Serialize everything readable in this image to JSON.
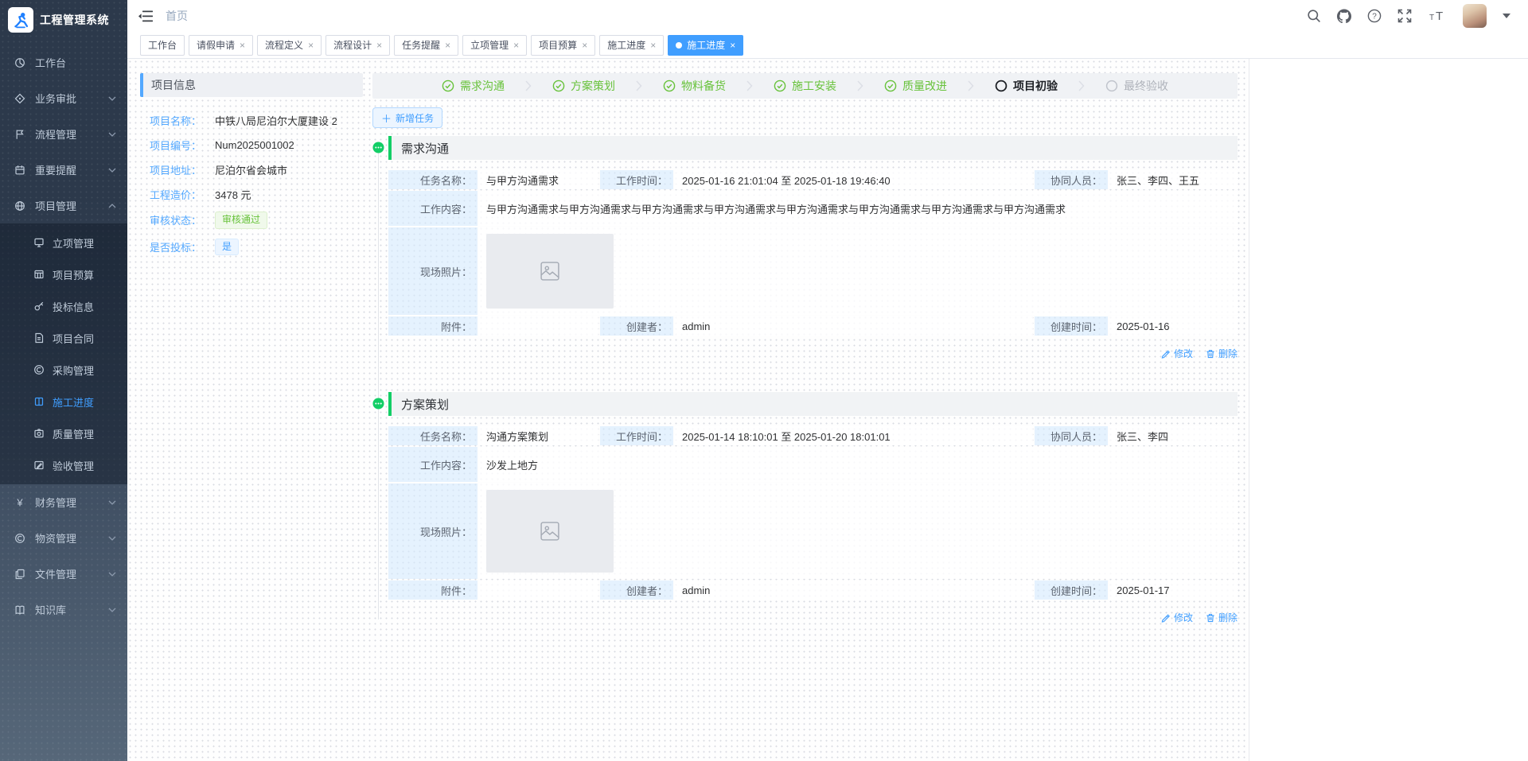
{
  "app": {
    "title": "工程管理系统",
    "breadcrumb": "首页"
  },
  "header": {
    "icons": [
      "search-icon",
      "github-icon",
      "help-icon",
      "fullscreen-icon",
      "font-size-icon",
      "avatar",
      "caret-down-icon"
    ]
  },
  "tabs": [
    {
      "label": "工作台",
      "closable": false,
      "active": false
    },
    {
      "label": "请假申请",
      "closable": true,
      "active": false
    },
    {
      "label": "流程定义",
      "closable": true,
      "active": false
    },
    {
      "label": "流程设计",
      "closable": true,
      "active": false
    },
    {
      "label": "任务提醒",
      "closable": true,
      "active": false
    },
    {
      "label": "立项管理",
      "closable": true,
      "active": false
    },
    {
      "label": "项目预算",
      "closable": true,
      "active": false
    },
    {
      "label": "施工进度",
      "closable": true,
      "active": false
    },
    {
      "label": "施工进度",
      "closable": true,
      "active": true
    }
  ],
  "sidebar": {
    "items": [
      {
        "label": "工作台",
        "icon": "dashboard-icon"
      },
      {
        "label": "业务审批",
        "icon": "approval-icon"
      },
      {
        "label": "流程管理",
        "icon": "process-icon"
      },
      {
        "label": "重要提醒",
        "icon": "reminder-icon"
      },
      {
        "label": "项目管理",
        "icon": "project-icon",
        "expanded": true,
        "children": [
          {
            "label": "立项管理",
            "icon": "initiation-icon"
          },
          {
            "label": "项目预算",
            "icon": "budget-icon"
          },
          {
            "label": "投标信息",
            "icon": "bid-icon"
          },
          {
            "label": "项目合同",
            "icon": "contract-icon"
          },
          {
            "label": "采购管理",
            "icon": "purchase-icon"
          },
          {
            "label": "施工进度",
            "icon": "progress-icon",
            "active": true
          },
          {
            "label": "质量管理",
            "icon": "quality-icon"
          },
          {
            "label": "验收管理",
            "icon": "acceptance-icon"
          }
        ]
      },
      {
        "label": "财务管理",
        "icon": "finance-icon"
      },
      {
        "label": "物资管理",
        "icon": "material-icon"
      },
      {
        "label": "文件管理",
        "icon": "file-icon"
      },
      {
        "label": "知识库",
        "icon": "knowledge-icon"
      }
    ]
  },
  "project_info": {
    "title": "项目信息",
    "fields": [
      {
        "label": "项目名称：",
        "value": "中铁八局尼泊尔大厦建设 2"
      },
      {
        "label": "项目编号：",
        "value": "Num2025001002"
      },
      {
        "label": "项目地址：",
        "value": "尼泊尔省会城市"
      },
      {
        "label": "工程造价：",
        "value": "3478 元"
      },
      {
        "label": "审核状态：",
        "value": "审核通过",
        "tag": "green"
      },
      {
        "label": "是否投标：",
        "value": "是",
        "tag": "blue"
      }
    ]
  },
  "steps": [
    {
      "label": "需求沟通",
      "status": "done"
    },
    {
      "label": "方案策划",
      "status": "done"
    },
    {
      "label": "物料备货",
      "status": "done"
    },
    {
      "label": "施工安装",
      "status": "done"
    },
    {
      "label": "质量改进",
      "status": "done"
    },
    {
      "label": "项目初验",
      "status": "current"
    },
    {
      "label": "最终验收",
      "status": "pending"
    }
  ],
  "toolbar": {
    "add_task_label": "新增任务"
  },
  "labels": {
    "task_name": "任务名称：",
    "work_time": "工作时间：",
    "collaborators": "协同人员：",
    "work_content": "工作内容：",
    "photos": "现场照片：",
    "attachment": "附件：",
    "creator": "创建者：",
    "created_at": "创建时间：",
    "edit": "修改",
    "delete": "删除"
  },
  "sections": [
    {
      "title": "需求沟通",
      "task_name": "与甲方沟通需求",
      "work_time": "2025-01-16 21:01:04 至 2025-01-18 19:46:40",
      "collaborators": "张三、李四、王五",
      "work_content": "与甲方沟通需求与甲方沟通需求与甲方沟通需求与甲方沟通需求与甲方沟通需求与甲方沟通需求与甲方沟通需求与甲方沟通需求",
      "attachment": "",
      "creator": "admin",
      "created_at": "2025-01-16"
    },
    {
      "title": "方案策划",
      "task_name": "沟通方案策划",
      "work_time": "2025-01-14 18:10:01 至 2025-01-20 18:01:01",
      "collaborators": "张三、李四",
      "work_content": "沙发上地方",
      "attachment": "",
      "creator": "admin",
      "created_at": "2025-01-17"
    }
  ],
  "colors": {
    "primary": "#409eff",
    "success": "#67c23a",
    "timeline_green": "#13ce66"
  }
}
